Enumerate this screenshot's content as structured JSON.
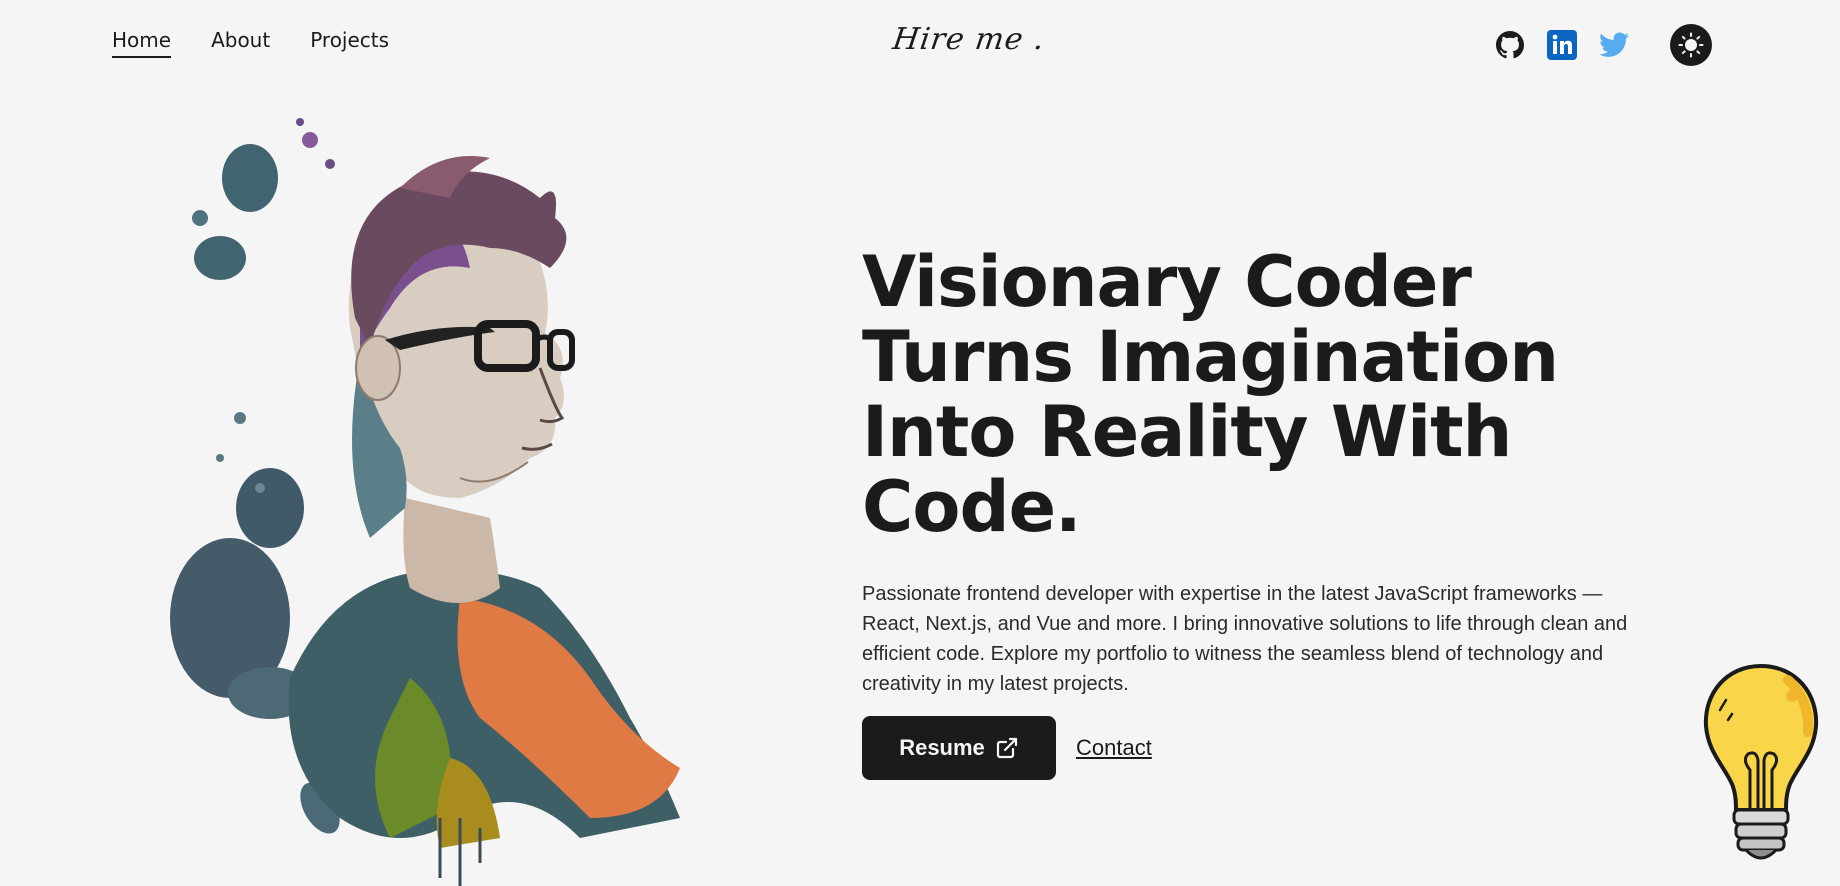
{
  "nav": {
    "items": [
      {
        "label": "Home",
        "active": true
      },
      {
        "label": "About",
        "active": false
      },
      {
        "label": "Projects",
        "active": false
      }
    ]
  },
  "logo": {
    "text": "Hire me ."
  },
  "socials": {
    "github_icon": "github-icon",
    "linkedin_icon": "linkedin-icon",
    "twitter_icon": "twitter-icon",
    "theme_icon": "sun-icon",
    "linkedin_color": "#0A66C2",
    "twitter_color": "#55ACEE"
  },
  "hero": {
    "headline": "Visionary Coder Turns Imagination Into Reality With Code.",
    "description": "Passionate frontend developer with expertise in the latest JavaScript frameworks — React, Next.js, and Vue and more. I bring innovative solutions to life through clean and efficient code. Explore my portfolio to witness the seamless blend of technology and creativity in my latest projects.",
    "resume_label": "Resume",
    "resume_icon": "external-link-icon",
    "contact_label": "Contact"
  },
  "colors": {
    "background": "#f5f5f5",
    "text": "#1b1b1b",
    "bulb": "#F9D649"
  }
}
